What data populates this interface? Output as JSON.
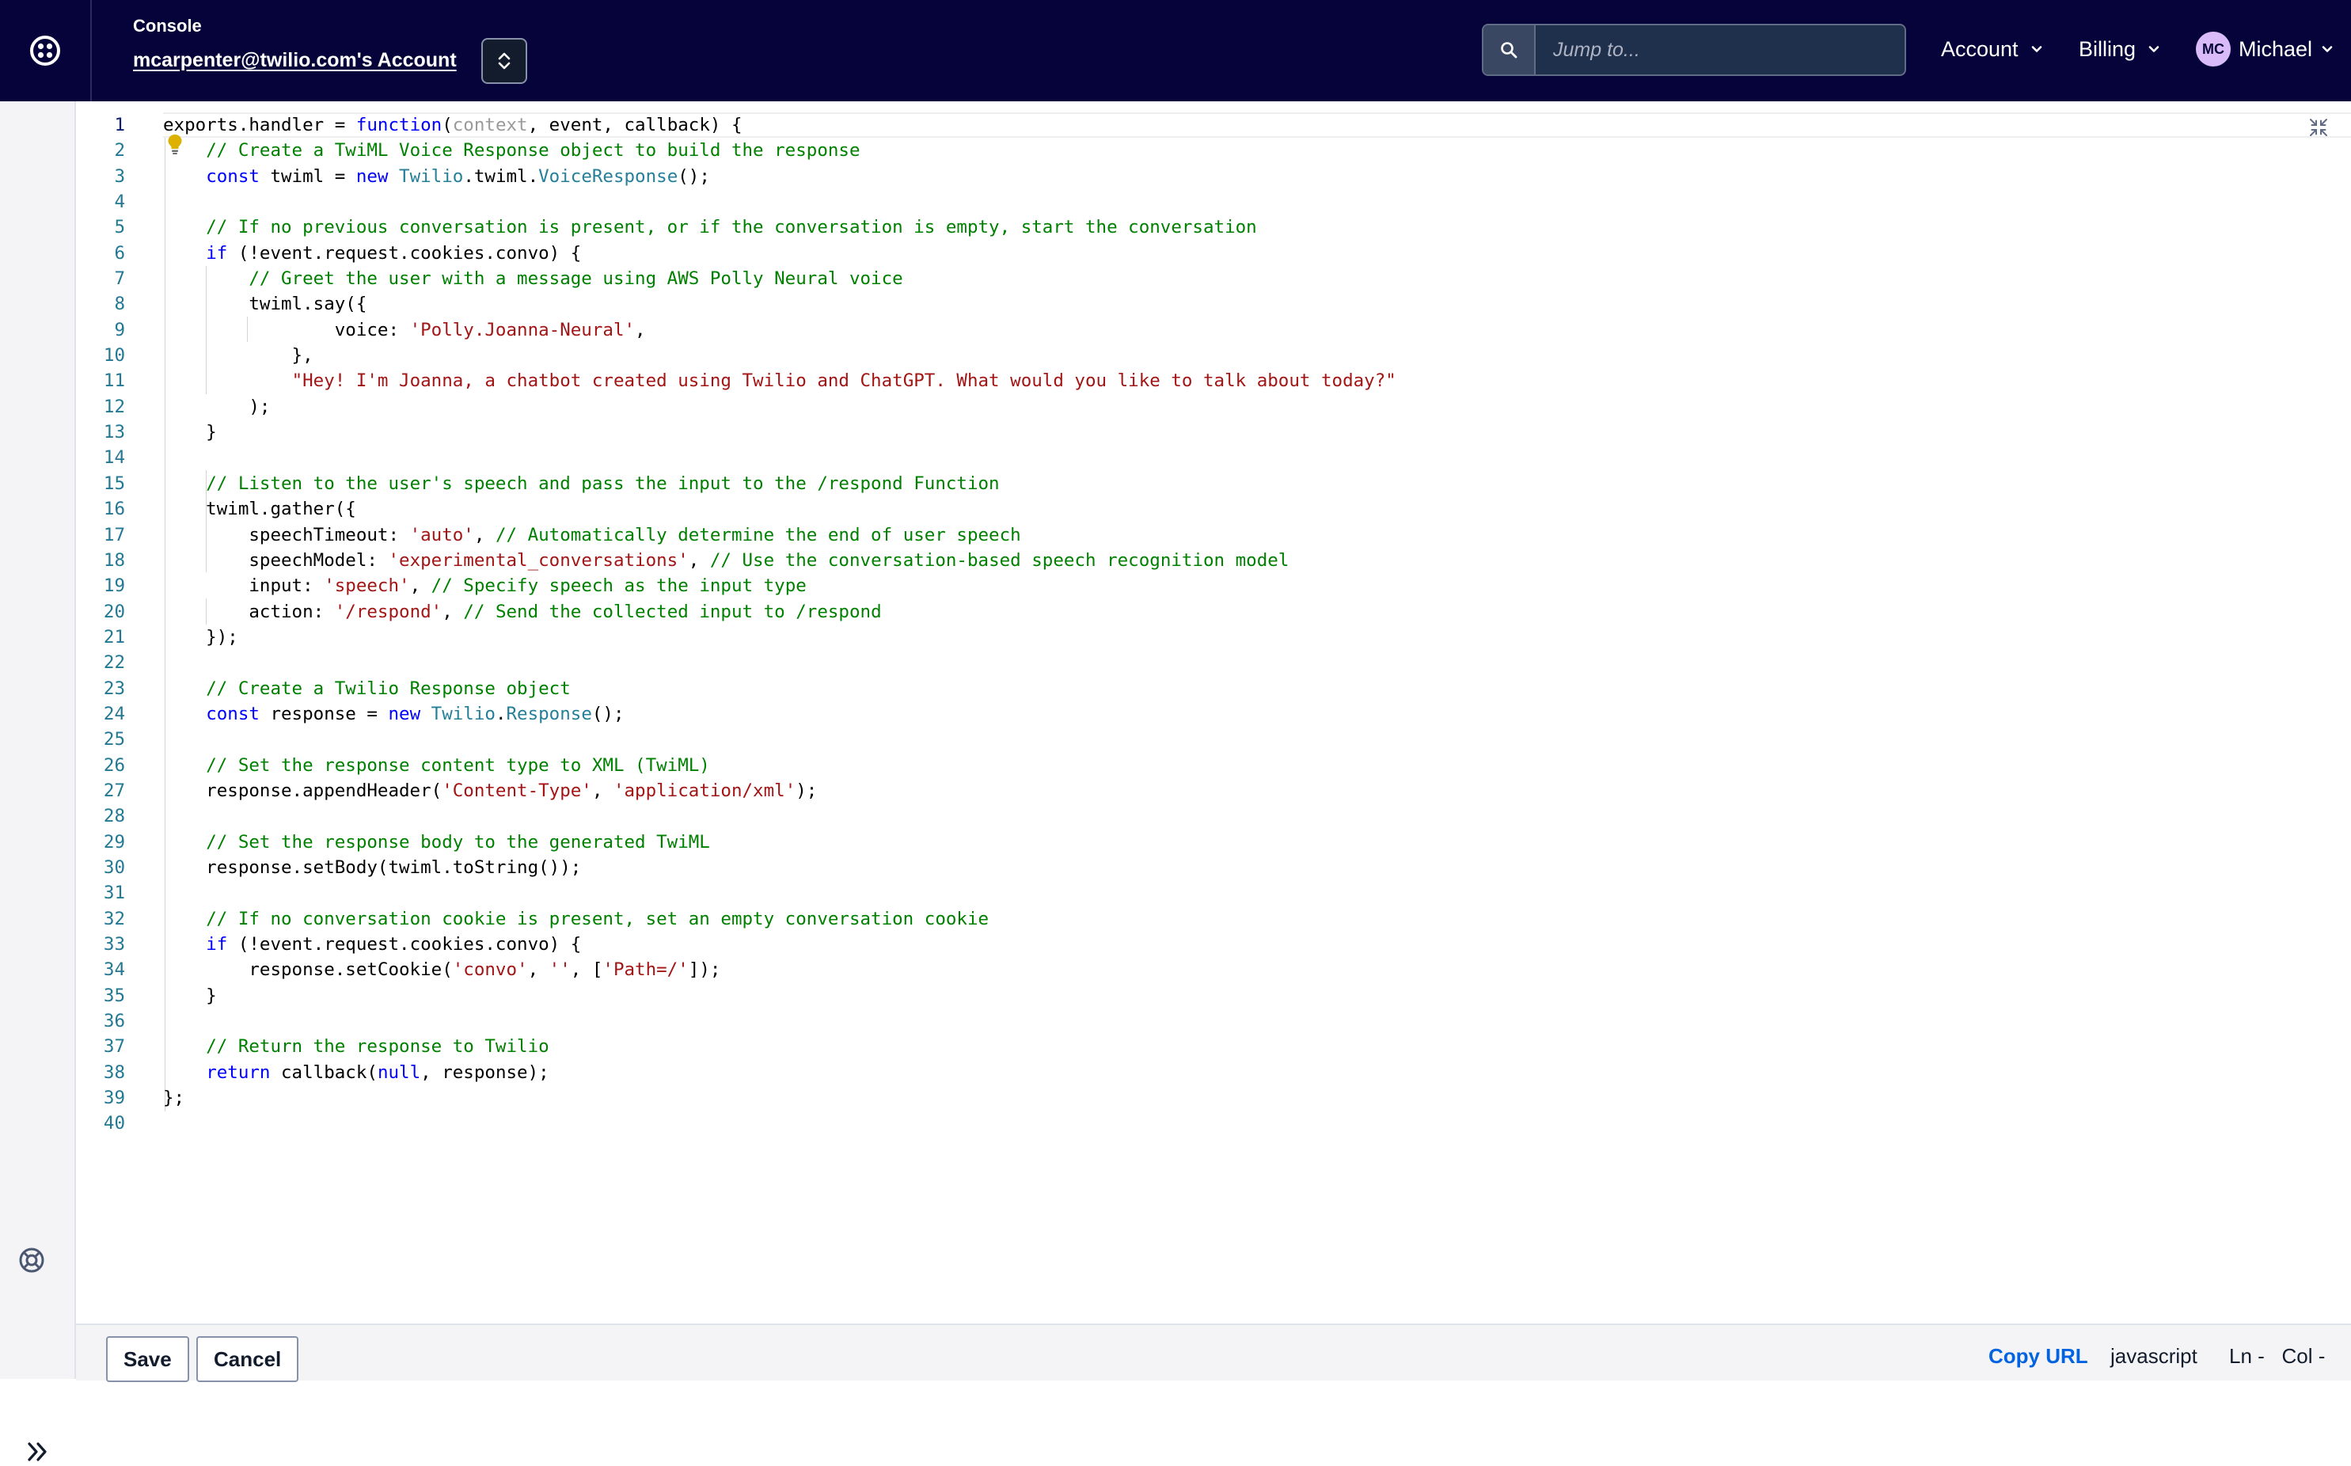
{
  "header": {
    "console_label": "Console",
    "account_name": "mcarpenter@twilio.com's Account",
    "search_placeholder": "Jump to...",
    "menus": [
      {
        "label": "Account"
      },
      {
        "label": "Billing"
      }
    ],
    "user": {
      "initials": "MC",
      "name": "Michael"
    }
  },
  "colors": {
    "topbar_bg": "#06033a",
    "link_blue": "#0263e0",
    "keyword": "#0000ff",
    "string": "#a31515",
    "comment": "#008000",
    "type": "#267f99"
  },
  "editor": {
    "language": "javascript",
    "active_line": 1,
    "lines": [
      [
        [
          "t",
          "exports.handler = "
        ],
        [
          "kw",
          "function"
        ],
        [
          "t",
          "("
        ],
        [
          "dim",
          "context"
        ],
        [
          "t",
          ", event, callback) {"
        ]
      ],
      [
        [
          "t",
          "    "
        ],
        [
          "com",
          "// Create a TwiML Voice Response object to build the response"
        ]
      ],
      [
        [
          "t",
          "    "
        ],
        [
          "kw",
          "const"
        ],
        [
          "t",
          " twiml = "
        ],
        [
          "kw",
          "new"
        ],
        [
          "t",
          " "
        ],
        [
          "typ",
          "Twilio"
        ],
        [
          "t",
          ".twiml."
        ],
        [
          "typ",
          "VoiceResponse"
        ],
        [
          "t",
          "();"
        ]
      ],
      [],
      [
        [
          "t",
          "    "
        ],
        [
          "com",
          "// If no previous conversation is present, or if the conversation is empty, start the conversation"
        ]
      ],
      [
        [
          "t",
          "    "
        ],
        [
          "kw",
          "if"
        ],
        [
          "t",
          " (!event.request.cookies.convo) {"
        ]
      ],
      [
        [
          "t",
          "        "
        ],
        [
          "com",
          "// Greet the user with a message using AWS Polly Neural voice"
        ]
      ],
      [
        [
          "t",
          "        twiml.say({"
        ]
      ],
      [
        [
          "t",
          "                voice: "
        ],
        [
          "str",
          "'Polly.Joanna-Neural'"
        ],
        [
          "t",
          ","
        ]
      ],
      [
        [
          "t",
          "            },"
        ]
      ],
      [
        [
          "t",
          "            "
        ],
        [
          "str",
          "\"Hey! I'm Joanna, a chatbot created using Twilio and ChatGPT. What would you like to talk about today?\""
        ]
      ],
      [
        [
          "t",
          "        );"
        ]
      ],
      [
        [
          "t",
          "    }"
        ]
      ],
      [],
      [
        [
          "t",
          "    "
        ],
        [
          "com",
          "// Listen to the user's speech and pass the input to the /respond Function"
        ]
      ],
      [
        [
          "t",
          "    twiml.gather({"
        ]
      ],
      [
        [
          "t",
          "        speechTimeout: "
        ],
        [
          "str",
          "'auto'"
        ],
        [
          "t",
          ", "
        ],
        [
          "com",
          "// Automatically determine the end of user speech"
        ]
      ],
      [
        [
          "t",
          "        speechModel: "
        ],
        [
          "str",
          "'experimental_conversations'"
        ],
        [
          "t",
          ", "
        ],
        [
          "com",
          "// Use the conversation-based speech recognition model"
        ]
      ],
      [
        [
          "t",
          "        input: "
        ],
        [
          "str",
          "'speech'"
        ],
        [
          "t",
          ", "
        ],
        [
          "com",
          "// Specify speech as the input type"
        ]
      ],
      [
        [
          "t",
          "        action: "
        ],
        [
          "str",
          "'/respond'"
        ],
        [
          "t",
          ", "
        ],
        [
          "com",
          "// Send the collected input to /respond"
        ]
      ],
      [
        [
          "t",
          "    });"
        ]
      ],
      [],
      [
        [
          "t",
          "    "
        ],
        [
          "com",
          "// Create a Twilio Response object"
        ]
      ],
      [
        [
          "t",
          "    "
        ],
        [
          "kw",
          "const"
        ],
        [
          "t",
          " response = "
        ],
        [
          "kw",
          "new"
        ],
        [
          "t",
          " "
        ],
        [
          "typ",
          "Twilio"
        ],
        [
          "t",
          "."
        ],
        [
          "typ",
          "Response"
        ],
        [
          "t",
          "();"
        ]
      ],
      [],
      [
        [
          "t",
          "    "
        ],
        [
          "com",
          "// Set the response content type to XML (TwiML)"
        ]
      ],
      [
        [
          "t",
          "    response.appendHeader("
        ],
        [
          "str",
          "'Content-Type'"
        ],
        [
          "t",
          ", "
        ],
        [
          "str",
          "'application/xml'"
        ],
        [
          "t",
          ");"
        ]
      ],
      [],
      [
        [
          "t",
          "    "
        ],
        [
          "com",
          "// Set the response body to the generated TwiML"
        ]
      ],
      [
        [
          "t",
          "    response.setBody(twiml.toString());"
        ]
      ],
      [],
      [
        [
          "t",
          "    "
        ],
        [
          "com",
          "// If no conversation cookie is present, set an empty conversation cookie"
        ]
      ],
      [
        [
          "t",
          "    "
        ],
        [
          "kw",
          "if"
        ],
        [
          "t",
          " (!event.request.cookies.convo) {"
        ]
      ],
      [
        [
          "t",
          "        response.setCookie("
        ],
        [
          "str",
          "'convo'"
        ],
        [
          "t",
          ", "
        ],
        [
          "str",
          "''"
        ],
        [
          "t",
          ", ["
        ],
        [
          "str",
          "'Path=/'"
        ],
        [
          "t",
          "]);"
        ]
      ],
      [
        [
          "t",
          "    }"
        ]
      ],
      [],
      [
        [
          "t",
          "    "
        ],
        [
          "com",
          "// Return the response to Twilio"
        ]
      ],
      [
        [
          "t",
          "    "
        ],
        [
          "kw",
          "return"
        ],
        [
          "t",
          " callback("
        ],
        [
          "kw",
          "null"
        ],
        [
          "t",
          ", response);"
        ]
      ],
      [
        [
          "t",
          "};"
        ]
      ],
      []
    ]
  },
  "footer": {
    "save_label": "Save",
    "cancel_label": "Cancel",
    "copy_url_label": "Copy URL",
    "language": "javascript",
    "position": "Ln -   Col -"
  },
  "icons": {
    "logo": "twilio-logo-icon",
    "switcher": "chevron-up-down-icon",
    "search": "search-icon",
    "dropdown": "chevron-down-icon",
    "help": "lifebuoy-icon",
    "expand": "double-chevron-right-icon",
    "lightbulb": "lightbulb-icon",
    "minimize": "minimize-icon"
  }
}
